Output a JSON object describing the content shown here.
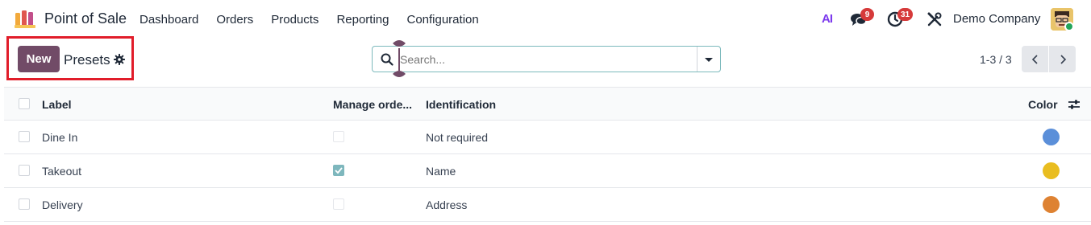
{
  "app": {
    "name": "Point of Sale"
  },
  "menu": [
    {
      "label": "Dashboard"
    },
    {
      "label": "Orders"
    },
    {
      "label": "Products"
    },
    {
      "label": "Reporting"
    },
    {
      "label": "Configuration"
    }
  ],
  "systray": {
    "ai_label": "AI",
    "chat_count": "9",
    "activity_count": "31",
    "company": "Demo Company"
  },
  "control": {
    "new_label": "New",
    "title": "Presets",
    "search_placeholder": "Search...",
    "pager": "1-3 / 3"
  },
  "table": {
    "columns": {
      "label": "Label",
      "manage_orders": "Manage orde...",
      "identification": "Identification",
      "color": "Color"
    },
    "rows": [
      {
        "label": "Dine In",
        "manage_orders": false,
        "identification": "Not required",
        "color": "#5b8fd9"
      },
      {
        "label": "Takeout",
        "manage_orders": true,
        "identification": "Name",
        "color": "#e9bd20"
      },
      {
        "label": "Delivery",
        "manage_orders": false,
        "identification": "Address",
        "color": "#de8232"
      }
    ]
  },
  "colors": {
    "brand": "#714b67",
    "highlight": "#e11d2a",
    "badge": "#d63a3a"
  }
}
